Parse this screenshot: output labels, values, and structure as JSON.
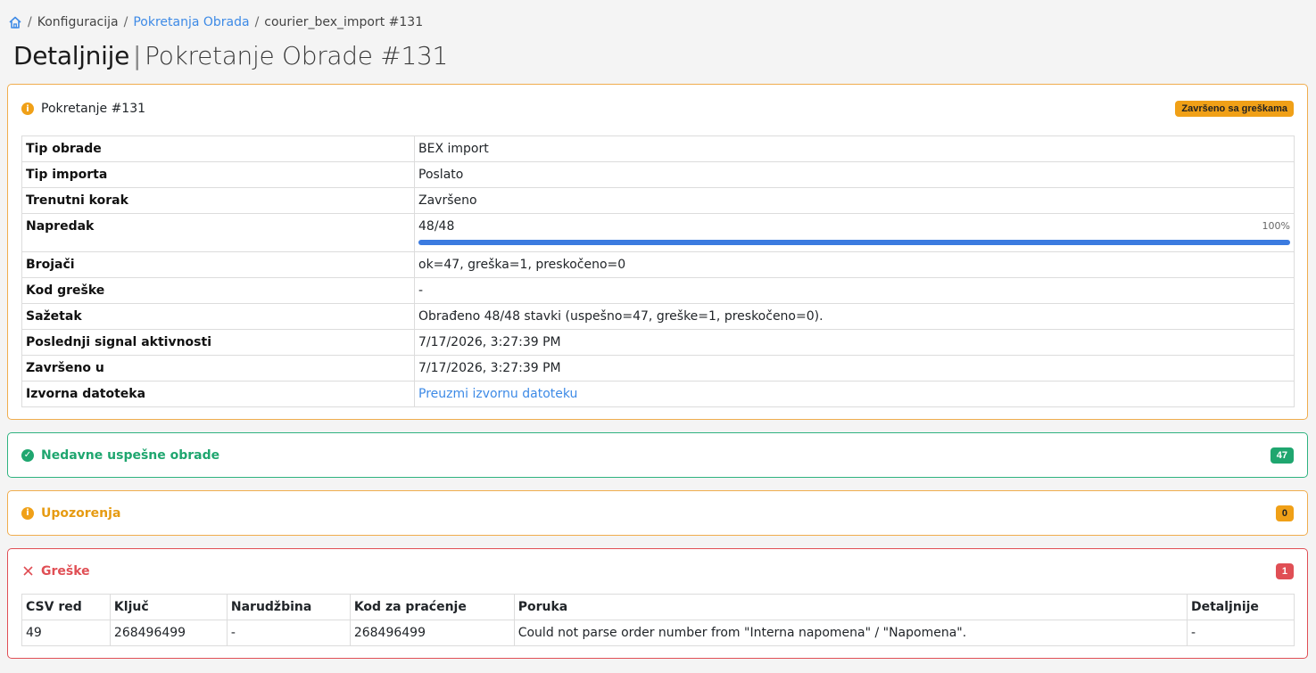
{
  "breadcrumb": {
    "items": [
      "Konfiguracija",
      "Pokretanja Obrada",
      "courier_bex_import #131"
    ]
  },
  "title": {
    "main": "Detaljnije",
    "sub": "Pokretanje Obrade #131"
  },
  "run_card": {
    "title": "Pokretanje #131",
    "status_badge": "Završeno sa greškama",
    "rows": [
      {
        "label": "Tip obrade",
        "value": "BEX import"
      },
      {
        "label": "Tip importa",
        "value": "Poslato"
      },
      {
        "label": "Trenutni korak",
        "value": "Završeno"
      },
      {
        "label": "Napredak",
        "value": "48/48",
        "percent_label": "100%",
        "progress": 1.0
      },
      {
        "label": "Brojači",
        "value": "ok=47, greška=1, preskočeno=0"
      },
      {
        "label": "Kod greške",
        "value": "-"
      },
      {
        "label": "Sažetak",
        "value": "Obrađeno 48/48 stavki (uspešno=47, greške=1, preskočeno=0)."
      },
      {
        "label": "Poslednji signal aktivnosti",
        "value": "7/17/2026, 3:27:39 PM"
      },
      {
        "label": "Završeno u",
        "value": "7/17/2026, 3:27:39 PM"
      },
      {
        "label": "Izvorna datoteka",
        "value": "Preuzmi izvornu datoteku"
      }
    ]
  },
  "ok_card": {
    "title": "Nedavne uspešne obrade",
    "count": "47"
  },
  "warn_card": {
    "title": "Upozorenja",
    "count": "0"
  },
  "err_card": {
    "title": "Greške",
    "count": "1",
    "columns": [
      "CSV red",
      "Ključ",
      "Narudžbina",
      "Kod za praćenje",
      "Poruka",
      "Detaljnije"
    ],
    "rows": [
      [
        "49",
        "268496499",
        "-",
        "268496499",
        "Could not parse order number from \"Interna napomena\" / \"Napomena\".",
        "-"
      ]
    ]
  },
  "colors": {
    "accent": "#3d8ae6",
    "warning": "#f0ad4e",
    "success": "#2fb380",
    "danger": "#e04f55",
    "progress": "#3b7be0"
  },
  "icons": {
    "home": "home-icon",
    "info": "info-icon",
    "check": "check-circle-icon",
    "close": "close-icon"
  }
}
